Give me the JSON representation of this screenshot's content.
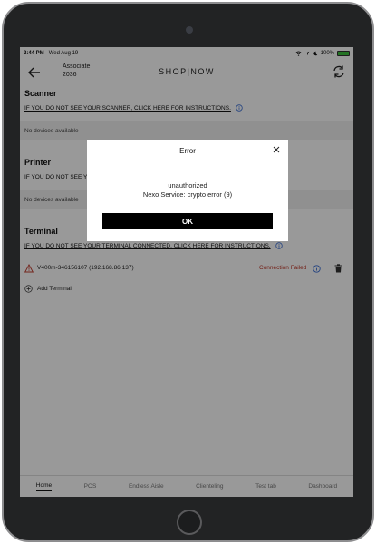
{
  "status_bar": {
    "time": "2:44 PM",
    "date": "Wed Aug 19",
    "battery": "100%",
    "icons": [
      "wifi-icon",
      "location-icon",
      "moon-icon",
      "battery-icon"
    ]
  },
  "header": {
    "associate_label": "Associate",
    "associate_id": "2036",
    "brand": "SHOP|NOW",
    "icons": [
      "back-arrow-icon",
      "refresh-icon"
    ]
  },
  "scanner": {
    "title": "Scanner",
    "instructions": "IF YOU DO NOT SEE YOUR SCANNER, CLICK HERE FOR INSTRUCTIONS.",
    "no_devices": "No devices available"
  },
  "printer": {
    "title": "Printer",
    "instructions": "IF YOU DO NOT SEE YOUR PRINTER, CLICK HERE FOR INSTRUCTIONS.",
    "no_devices": "No devices available"
  },
  "terminal": {
    "title": "Terminal",
    "instructions": "IF YOU DO NOT SEE YOUR TERMINAL CONNECTED, CLICK HERE FOR INSTRUCTIONS.",
    "device_name": "V400m-346156107 (192.168.86.137)",
    "device_status": "Connection Failed",
    "add_label": "Add Terminal"
  },
  "tabs": [
    {
      "label": "Home",
      "active": true
    },
    {
      "label": "POS",
      "active": false
    },
    {
      "label": "Endless Aisle",
      "active": false
    },
    {
      "label": "Clienteling",
      "active": false
    },
    {
      "label": "Test tab",
      "active": false
    },
    {
      "label": "Dashboard",
      "active": false
    }
  ],
  "dialog": {
    "title": "Error",
    "message_line1": "unauthorized",
    "message_line2": "Nexo Service: crypto error (9)",
    "ok_label": "OK"
  },
  "colors": {
    "error_text": "#c0392b",
    "info_icon": "#3b6fd6",
    "overlay": "#000000"
  }
}
